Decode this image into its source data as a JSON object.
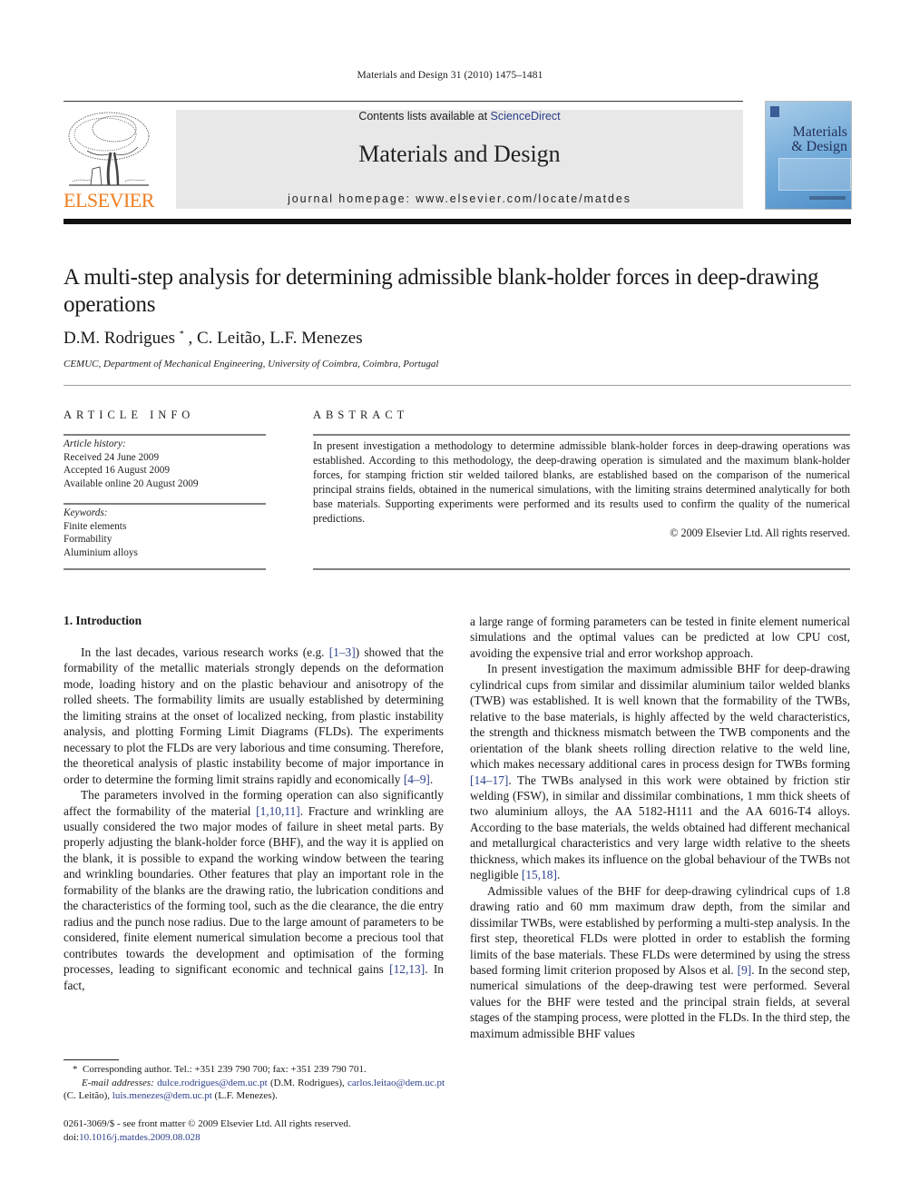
{
  "running_head": "Materials and Design 31 (2010) 1475–1481",
  "banner": {
    "contents_prefix": "Contents lists available at ",
    "contents_link": "ScienceDirect",
    "journal_title": "Materials and Design",
    "homepage": "journal homepage: www.elsevier.com/locate/matdes"
  },
  "publisher": {
    "logo_icon": "elsevier-tree-icon",
    "name": "ELSEVIER",
    "brand_color": "#f07d1f"
  },
  "cover": {
    "title_line1": "Materials",
    "title_line2": "& Design"
  },
  "article": {
    "title": "A multi-step analysis for determining admissible blank-holder forces in deep-drawing operations",
    "authors": [
      {
        "name": "D.M. Rodrigues",
        "mark": "*"
      },
      {
        "name": "C. Leitão"
      },
      {
        "name": "L.F. Menezes"
      }
    ],
    "author_sep": ", ",
    "affiliation": "CEMUC, Department of Mechanical Engineering, University of Coimbra, Coimbra, Portugal"
  },
  "article_info": {
    "heading": "ARTICLE INFO",
    "history_label": "Article history:",
    "history": [
      "Received 24 June 2009",
      "Accepted 16 August 2009",
      "Available online 20 August 2009"
    ],
    "keywords_label": "Keywords:",
    "keywords": [
      "Finite elements",
      "Formability",
      "Aluminium alloys"
    ]
  },
  "abstract": {
    "heading": "ABSTRACT",
    "text": "In present investigation a methodology to determine admissible blank-holder forces in deep-drawing operations was established. According to this methodology, the deep-drawing operation is simulated and the maximum blank-holder forces, for stamping friction stir welded tailored blanks, are established based on the comparison of the numerical principal strains fields, obtained in the numerical simulations, with the limiting strains determined analytically for both base materials. Supporting experiments were performed and its results used to confirm the quality of the numerical predictions.",
    "copyright": "© 2009 Elsevier Ltd. All rights reserved."
  },
  "body": {
    "section_heading": "1. Introduction",
    "left_column": [
      {
        "segments": [
          {
            "t": "In the last decades, various research works (e.g. "
          },
          {
            "t": "[1–3]",
            "ref": true
          },
          {
            "t": ") showed that the formability of the metallic materials strongly depends on the deformation mode, loading history and on the plastic behaviour and anisotropy of the rolled sheets. The formability limits are usually established by determining the limiting strains at the onset of localized necking, from plastic instability analysis, and plotting Forming Limit Diagrams (FLDs). The experiments necessary to plot the FLDs are very laborious and time consuming. Therefore, the theoretical analysis of plastic instability become of major importance in order to determine the forming limit strains rapidly and economically "
          },
          {
            "t": "[4–9]",
            "ref": true
          },
          {
            "t": "."
          }
        ]
      },
      {
        "segments": [
          {
            "t": "The parameters involved in the forming operation can also significantly affect the formability of the material "
          },
          {
            "t": "[1,10,11]",
            "ref": true
          },
          {
            "t": ". Fracture and wrinkling are usually considered the two major modes of failure in sheet metal parts. By properly adjusting the blank-holder force (BHF), and the way it is applied on the blank, it is possible to expand the working window between the tearing and wrinkling boundaries. Other features that play an important role in the formability of the blanks are the drawing ratio, the lubrication conditions and the characteristics of the forming tool, such as the die clearance, the die entry radius and the punch nose radius. Due to the large amount of parameters to be considered, finite element numerical simulation become a precious tool that contributes towards the development and optimisation of the forming processes, leading to significant economic and technical gains "
          },
          {
            "t": "[12,13]",
            "ref": true
          },
          {
            "t": ". In fact,"
          }
        ]
      }
    ],
    "right_column": [
      {
        "continuation": true,
        "segments": [
          {
            "t": "a large range of forming parameters can be tested in finite element numerical simulations and the optimal values can be predicted at low CPU cost, avoiding the expensive trial and error workshop approach."
          }
        ]
      },
      {
        "segments": [
          {
            "t": "In present investigation the maximum admissible BHF for deep-drawing cylindrical cups from similar and dissimilar aluminium tailor welded blanks (TWB) was established. It is well known that the formability of the TWBs, relative to the base materials, is highly affected by the weld characteristics, the strength and thickness mismatch between the TWB components and the orientation of the blank sheets rolling direction relative to the weld line, which makes necessary additional cares in process design for TWBs forming "
          },
          {
            "t": "[14–17]",
            "ref": true
          },
          {
            "t": ". The TWBs analysed in this work were obtained by friction stir welding (FSW), in similar and dissimilar combinations, 1 mm thick sheets of two aluminium alloys, the AA 5182-H111 and the AA 6016-T4 alloys. According to the base materials, the welds obtained had different mechanical and metallurgical characteristics and very large width relative to the sheets thickness, which makes its influence on the global behaviour of the TWBs not negligible "
          },
          {
            "t": "[15,18]",
            "ref": true
          },
          {
            "t": "."
          }
        ]
      },
      {
        "segments": [
          {
            "t": "Admissible values of the BHF for deep-drawing cylindrical cups of 1.8 drawing ratio and 60 mm maximum draw depth, from the similar and dissimilar TWBs, were established by performing a multi-step analysis. In the first step, theoretical FLDs were plotted in order to establish the forming limits of the base materials. These FLDs were determined by using the stress based forming limit criterion proposed by Alsos et al. "
          },
          {
            "t": "[9]",
            "ref": true
          },
          {
            "t": ". In the second step, numerical simulations of the deep-drawing test were performed. Several values for the BHF were tested and the principal strain fields, at several stages of the stamping process, were plotted in the FLDs. In the third step, the maximum admissible BHF values"
          }
        ]
      }
    ]
  },
  "footnote": {
    "mark": "*",
    "corresponding": "Corresponding author. Tel.: +351 239 790 700; fax: +351 239 790 701.",
    "email_label": "E-mail addresses:",
    "emails": [
      {
        "address": "dulce.rodrigues@dem.uc.pt",
        "who": "(D.M. Rodrigues)"
      },
      {
        "address": "carlos.leitao@dem.uc.pt",
        "who": "(C. Leitão)"
      },
      {
        "address": "luis.menezes@dem.uc.pt",
        "who": "(L.F. Menezes)."
      }
    ]
  },
  "front_matter": {
    "issn_line": "0261-3069/$ - see front matter © 2009 Elsevier Ltd. All rights reserved.",
    "doi_prefix": "doi:",
    "doi": "10.1016/j.matdes.2009.08.028"
  },
  "colors": {
    "link": "#2b3e8a",
    "banner_bg": "#e8e8e8",
    "publisher_orange": "#f07d1f"
  }
}
